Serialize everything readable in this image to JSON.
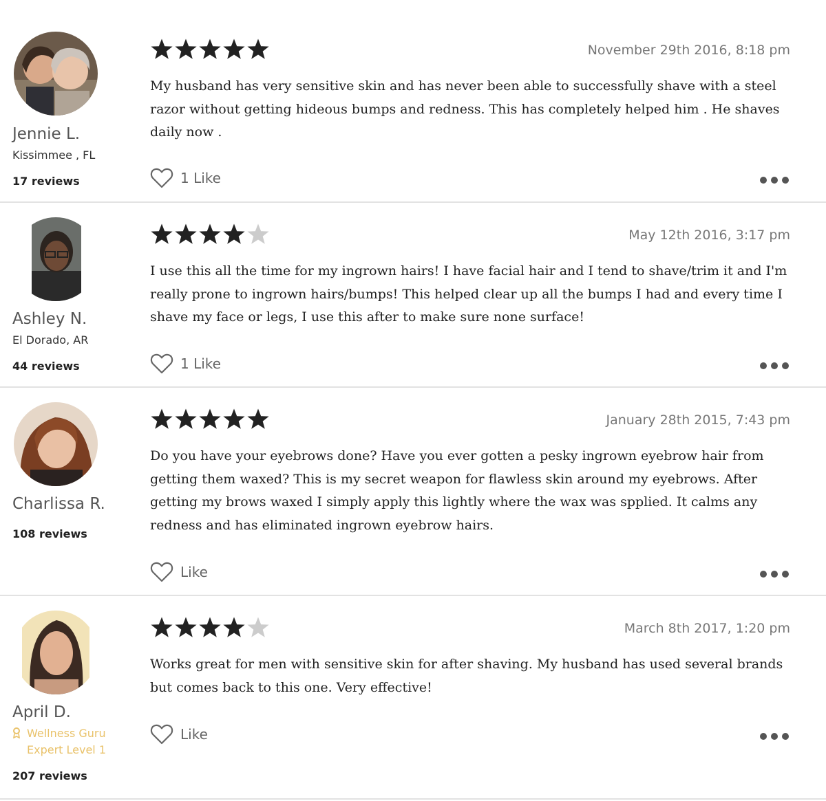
{
  "reviews": [
    {
      "name": "Jennie L.",
      "location": "Kissimmee , FL",
      "reviews_count": "17 reviews",
      "rating": 5,
      "date": "November 29th 2016, 8:18 pm",
      "text": "My husband has very sensitive skin and has never been able to successfully shave with a steel razor without getting hideous bumps and redness. This has completely helped him . He shaves daily now .",
      "like_label": "1 Like"
    },
    {
      "name": "Ashley N.",
      "location": "El Dorado, AR",
      "reviews_count": "44 reviews",
      "rating": 4,
      "date": "May 12th 2016, 3:17 pm",
      "text": "I use this all the time for my ingrown hairs! I have facial hair and I tend to shave/trim it and I'm really prone to ingrown hairs/bumps! This helped clear up all the bumps I had and every time I shave my face or legs, I use this after to make sure none surface!",
      "like_label": "1 Like"
    },
    {
      "name": "Charlissa R.",
      "reviews_count": "108 reviews",
      "rating": 5,
      "date": "January 28th 2015, 7:43 pm",
      "text": "Do you have your eyebrows done? Have you ever gotten a pesky ingrown eyebrow hair from getting them waxed? This is my secret weapon for flawless skin around my eyebrows. After getting my brows waxed I simply apply this lightly where the wax was spplied. It calms any redness and has eliminated ingrown eyebrow hairs.",
      "like_label": "Like"
    },
    {
      "name": "April D.",
      "badge": "Wellness Guru",
      "badge_level": "Expert Level 1",
      "reviews_count": "207 reviews",
      "rating": 4,
      "date": "March 8th 2017, 1:20 pm",
      "text": "Works great for men with sensitive skin for after shaving. My husband has used several brands but comes back to this one. Very effective!",
      "like_label": "Like"
    }
  ],
  "colors": {
    "star_filled": "#222222",
    "star_empty": "#cccccc",
    "badge": "#e9c26a",
    "divider": "#e2e2e2"
  },
  "icons": {
    "star": "star-icon",
    "like": "heart-outline-icon",
    "more": "more-dots-icon",
    "badge": "award-ribbon-icon"
  }
}
